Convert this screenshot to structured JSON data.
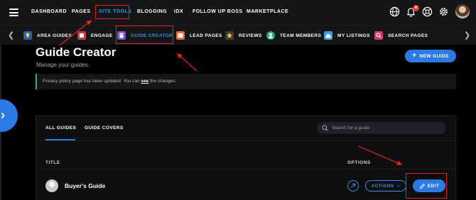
{
  "topnav": {
    "items": [
      {
        "label": "DASHBOARD"
      },
      {
        "label": "PAGES"
      },
      {
        "label": "SITE TOOLS"
      },
      {
        "label": "BLOGGING"
      },
      {
        "label": "IDX"
      },
      {
        "label": "FOLLOW UP BOSS"
      },
      {
        "label": "MARKETPLACE"
      }
    ],
    "active": "SITE TOOLS",
    "notifications_count": "8",
    "icons": [
      "globe-icon",
      "bell-icon",
      "help-icon",
      "gear-icon",
      "avatar"
    ]
  },
  "subnav": {
    "items": [
      {
        "label": "AREA GUIDES",
        "icon": "map-icon"
      },
      {
        "label": "ENGAGE",
        "icon": "engage-icon"
      },
      {
        "label": "GUIDE CREATOR",
        "icon": "guide-icon"
      },
      {
        "label": "LEAD PAGES",
        "icon": "lead-page-icon"
      },
      {
        "label": "REVIEWS",
        "icon": "star-icon"
      },
      {
        "label": "TEAM MEMBERS",
        "icon": "team-icon"
      },
      {
        "label": "MY LISTINGS",
        "icon": "listing-icon"
      },
      {
        "label": "SEARCH PAGES",
        "icon": "search-page-icon"
      }
    ],
    "active": "GUIDE CREATOR"
  },
  "page": {
    "title": "Guide Creator",
    "subtitle": "Manage your guides.",
    "new_button": "NEW GUIDE"
  },
  "alert": {
    "text_before": "Privacy policy page has been updated. You can ",
    "link": "see",
    "text_after": " the changes."
  },
  "card": {
    "tabs": [
      {
        "label": "ALL GUIDES"
      },
      {
        "label": "GUIDE COVERS"
      }
    ],
    "active_tab": "ALL GUIDES",
    "search_placeholder": "Search for a guide",
    "columns": {
      "title": "TITLE",
      "options": "OPTIONS"
    },
    "rows": [
      {
        "title": "Buyer's Guide",
        "actions_label": "ACTIONS",
        "edit_label": "EDIT"
      }
    ]
  },
  "colors": {
    "accent": "#2c7be5",
    "annotation": "#e02222",
    "alert_border": "#2fb36b",
    "background": "#000000"
  }
}
